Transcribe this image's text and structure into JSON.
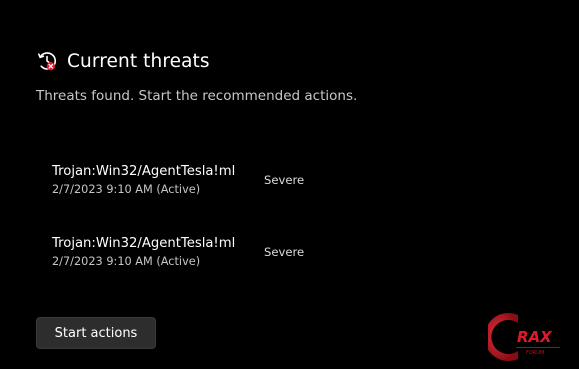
{
  "header": {
    "icon": "history-warning-icon",
    "title": "Current threats"
  },
  "subtitle": "Threats found. Start the recommended actions.",
  "threats": [
    {
      "name": "Trojan:Win32/AgentTesla!ml",
      "meta": "2/7/2023 9:10 AM (Active)",
      "severity": "Severe"
    },
    {
      "name": "Trojan:Win32/AgentTesla!ml",
      "meta": "2/7/2023 9:10 AM (Active)",
      "severity": "Severe"
    }
  ],
  "actions": {
    "start_label": "Start actions"
  },
  "watermark": {
    "text": "RAX",
    "subtext": "FORUM"
  },
  "colors": {
    "background": "#000000",
    "button": "#2d2d2d",
    "alert_red": "#e81123",
    "watermark_red": "#c0121f"
  }
}
